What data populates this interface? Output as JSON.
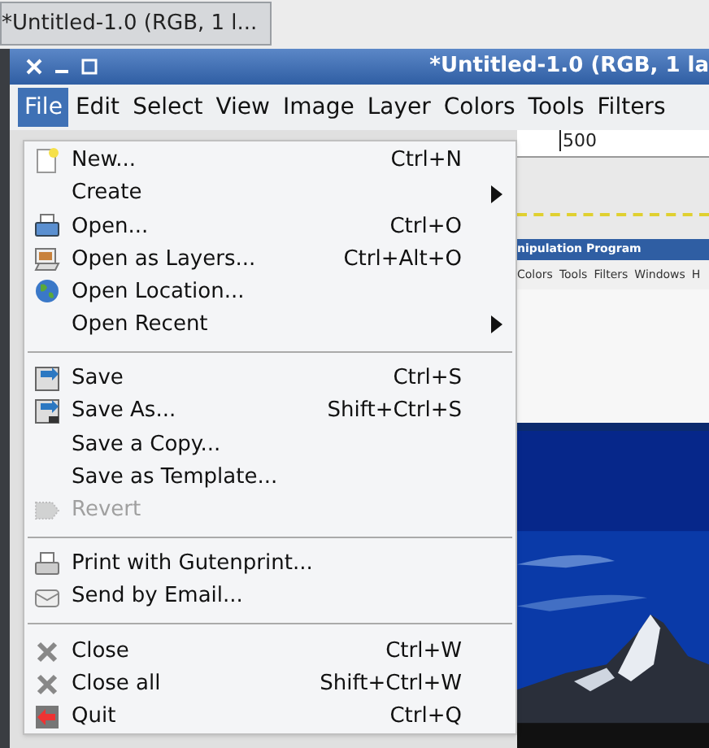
{
  "taskbar": {
    "title": "*Untitled-1.0 (RGB, 1 l..."
  },
  "window": {
    "title": "*Untitled-1.0 (RGB, 1 la"
  },
  "menubar": [
    {
      "label": "File",
      "selected": true
    },
    {
      "label": "Edit",
      "selected": false
    },
    {
      "label": "Select",
      "selected": false
    },
    {
      "label": "View",
      "selected": false
    },
    {
      "label": "Image",
      "selected": false
    },
    {
      "label": "Layer",
      "selected": false
    },
    {
      "label": "Colors",
      "selected": false
    },
    {
      "label": "Tools",
      "selected": false
    },
    {
      "label": "Filters",
      "selected": false
    }
  ],
  "file_menu": [
    {
      "kind": "item",
      "label": "New...",
      "shortcut": "Ctrl+N",
      "submenu": false,
      "disabled": false
    },
    {
      "kind": "item",
      "label": "Create",
      "submenu": true,
      "disabled": false
    },
    {
      "kind": "item",
      "label": "Open...",
      "shortcut": "Ctrl+O",
      "submenu": false,
      "disabled": false
    },
    {
      "kind": "item",
      "label": "Open as Layers...",
      "shortcut": "Ctrl+Alt+O",
      "submenu": false,
      "disabled": false
    },
    {
      "kind": "item",
      "label": "Open Location...",
      "submenu": false,
      "disabled": false
    },
    {
      "kind": "item",
      "label": "Open Recent",
      "submenu": true,
      "disabled": false
    },
    {
      "kind": "separator"
    },
    {
      "kind": "item",
      "label": "Save",
      "shortcut": "Ctrl+S",
      "submenu": false,
      "disabled": false
    },
    {
      "kind": "item",
      "label": "Save As...",
      "shortcut": "Shift+Ctrl+S",
      "submenu": false,
      "disabled": false
    },
    {
      "kind": "item",
      "label": "Save a Copy...",
      "submenu": false,
      "disabled": false
    },
    {
      "kind": "item",
      "label": "Save as Template...",
      "submenu": false,
      "disabled": false
    },
    {
      "kind": "item",
      "label": "Revert",
      "submenu": false,
      "disabled": true
    },
    {
      "kind": "separator"
    },
    {
      "kind": "item",
      "label": "Print with Gutenprint...",
      "submenu": false,
      "disabled": false
    },
    {
      "kind": "item",
      "label": "Send by Email...",
      "submenu": false,
      "disabled": false
    },
    {
      "kind": "separator"
    },
    {
      "kind": "item",
      "label": "Close",
      "shortcut": "Ctrl+W",
      "submenu": false,
      "disabled": false
    },
    {
      "kind": "item",
      "label": "Close all",
      "shortcut": "Shift+Ctrl+W",
      "submenu": false,
      "disabled": false
    },
    {
      "kind": "item",
      "label": "Quit",
      "shortcut": "Ctrl+Q",
      "submenu": false,
      "disabled": false
    }
  ],
  "ruler": {
    "label": "500"
  },
  "inner_window": {
    "title": "nipulation Program",
    "menubar": [
      "Colors",
      "Tools",
      "Filters",
      "Windows",
      "H"
    ]
  }
}
